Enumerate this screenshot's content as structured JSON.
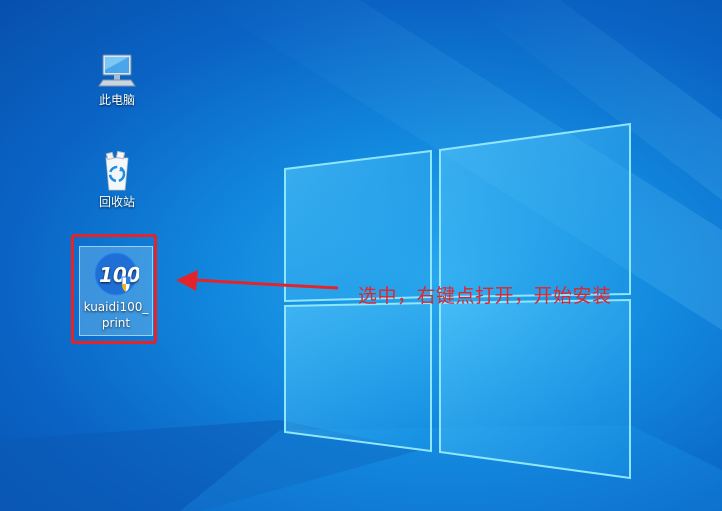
{
  "desktop": {
    "icons": [
      {
        "label": "此电脑",
        "icon": "computer-icon"
      },
      {
        "label": "回收站",
        "icon": "recycle-bin-icon"
      },
      {
        "label": "kuaidi100_print",
        "icon": "kuaidi100-app-icon",
        "logo_text": "100",
        "selected": true
      }
    ]
  },
  "annotation": {
    "text": "选中，右键点打开，开始安装",
    "color": "#e3242b"
  },
  "colors": {
    "wallpaper_dark": "#0750ad",
    "wallpaper_light": "#2aa9ee",
    "highlight": "#e3242b"
  }
}
